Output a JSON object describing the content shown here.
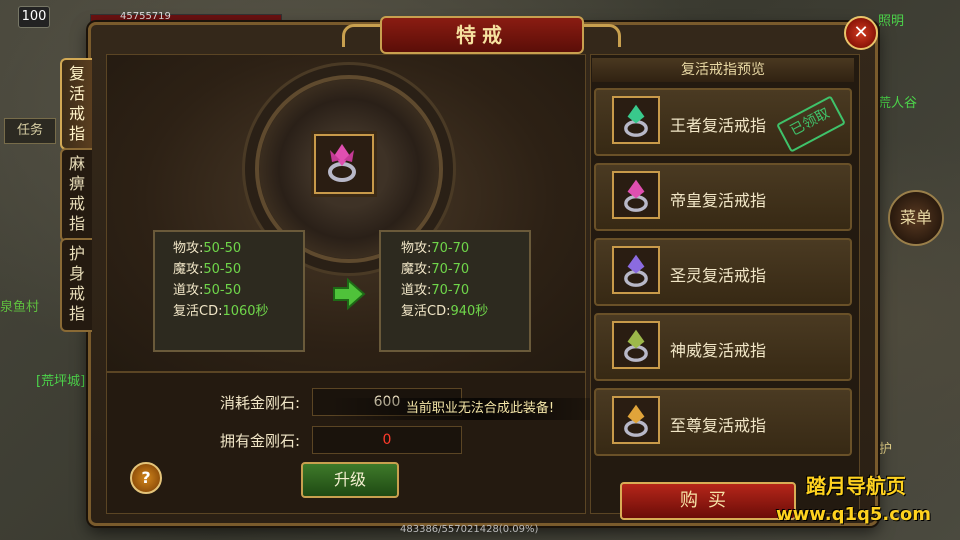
{
  "hud": {
    "level": "100",
    "hp_text": "45755719"
  },
  "map_labels": {
    "task": "任务",
    "left_1": "泉鱼村",
    "left_2": "[荒坪城]",
    "right_1": "照明",
    "right_2": "荒人谷",
    "right_3": "神护"
  },
  "menu_label": "菜单",
  "panel": {
    "title": "特戒",
    "close": "✕"
  },
  "tabs": [
    {
      "label": "复活戒指"
    },
    {
      "label": "麻痹戒指"
    },
    {
      "label": "护身戒指"
    }
  ],
  "current_stats": {
    "rows": [
      {
        "label": "物攻:",
        "value": "50-50"
      },
      {
        "label": "魔攻:",
        "value": "50-50"
      },
      {
        "label": "道攻:",
        "value": "50-50"
      },
      {
        "label": "复活CD:",
        "value": "1060秒"
      }
    ]
  },
  "next_stats": {
    "rows": [
      {
        "label": "物攻:",
        "value": "70-70"
      },
      {
        "label": "魔攻:",
        "value": "70-70"
      },
      {
        "label": "道攻:",
        "value": "70-70"
      },
      {
        "label": "复活CD:",
        "value": "940秒"
      }
    ]
  },
  "cost": {
    "consume_label": "消耗金刚石:",
    "consume_value": "600",
    "own_label": "拥有金刚石:",
    "own_value": "0"
  },
  "toast": "当前职业无法合成此装备!",
  "upgrade_label": "升级",
  "help_label": "?",
  "preview": {
    "header": "复活戒指预览",
    "items": [
      {
        "name": "王者复活戒指",
        "stamp": "已领取",
        "gem_color": "#39c98c"
      },
      {
        "name": "帝皇复活戒指",
        "stamp": "",
        "gem_color": "#e04fb0"
      },
      {
        "name": "圣灵复活戒指",
        "stamp": "",
        "gem_color": "#8b6be0"
      },
      {
        "name": "神威复活戒指",
        "stamp": "",
        "gem_color": "#9db84a"
      },
      {
        "name": "至尊复活戒指",
        "stamp": "",
        "gem_color": "#e0a43a"
      }
    ]
  },
  "buy_label": "购买",
  "status_bar": "483386/557021428(0.09%)",
  "watermark": {
    "line1": "踏月导航页",
    "line2": "www.q1q5.com"
  }
}
